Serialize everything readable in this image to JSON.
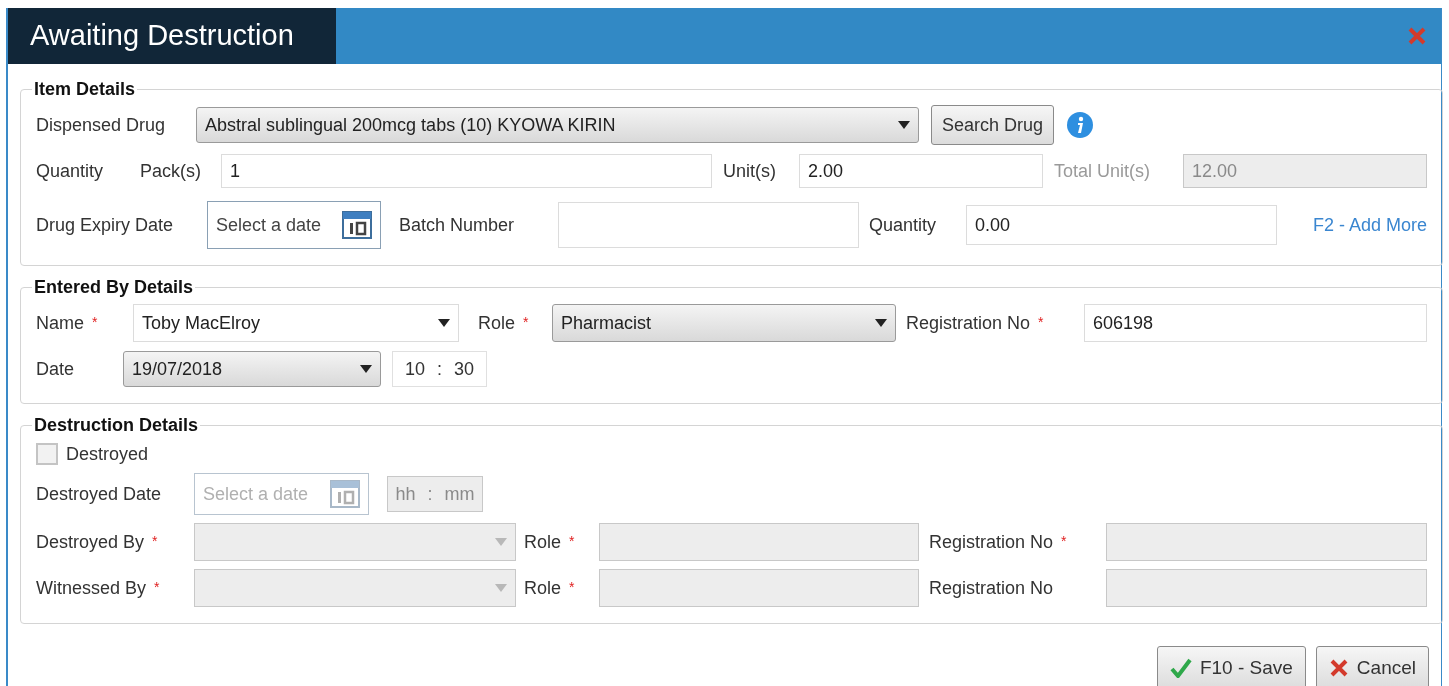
{
  "window": {
    "title": "Awaiting Destruction"
  },
  "item_details": {
    "legend": "Item Details",
    "dispensed_drug": {
      "label": "Dispensed Drug",
      "value": "Abstral sublingual 200mcg tabs (10) KYOWA KIRIN",
      "kind": "select"
    },
    "search_button": "Search Drug",
    "quantity_label": "Quantity",
    "packs": {
      "label": "Pack(s)",
      "value": "1",
      "disabled": false
    },
    "units": {
      "label": "Unit(s)",
      "value": "2.00",
      "disabled": false
    },
    "total_units": {
      "label": "Total Unit(s)",
      "value": "12.00",
      "disabled": true
    },
    "expiry": {
      "label": "Drug Expiry Date",
      "placeholder": "Select a date",
      "disabled": false
    },
    "batch": {
      "label": "Batch Number",
      "disabled": false
    },
    "quantity": {
      "label": "Quantity",
      "value": "0.00",
      "disabled": false
    },
    "add_more": "F2 - Add More"
  },
  "entered_by": {
    "legend": "Entered By Details",
    "name": {
      "label": "Name",
      "marker": "*",
      "value": "Toby MacElroy",
      "kind": "combo"
    },
    "role": {
      "label": "Role",
      "marker": "*",
      "value": "Pharmacist",
      "kind": "select"
    },
    "registration": {
      "label": "Registration No",
      "marker": "*",
      "value": "606198",
      "disabled": false
    },
    "date": {
      "label": "Date",
      "value": "19/07/2018",
      "kind": "select"
    },
    "time": {
      "hours": "10",
      "separator": ":",
      "minutes": "30",
      "disabled": false
    }
  },
  "destruction": {
    "legend": "Destruction Details",
    "destroyed": {
      "label": "Destroyed",
      "checked": false
    },
    "destroyed_date": {
      "label": "Destroyed Date",
      "placeholder": "Select a date",
      "disabled": true
    },
    "time": {
      "hours": "hh",
      "separator": ":",
      "minutes": "mm",
      "disabled": true
    },
    "rows": [
      {
        "label": "Destroyed By",
        "marker": "*",
        "role_label": "Role",
        "role_marker": "*",
        "reg_label": "Registration No",
        "reg_marker": "*",
        "disabled": true
      },
      {
        "label": "Witnessed By",
        "marker": "*",
        "role_label": "Role",
        "role_marker": "*",
        "reg_label": "Registration No",
        "disabled": true
      }
    ]
  },
  "buttons": [
    {
      "kind": "save",
      "label": "F10 - Save"
    },
    {
      "kind": "cancel",
      "label": "Cancel"
    }
  ]
}
